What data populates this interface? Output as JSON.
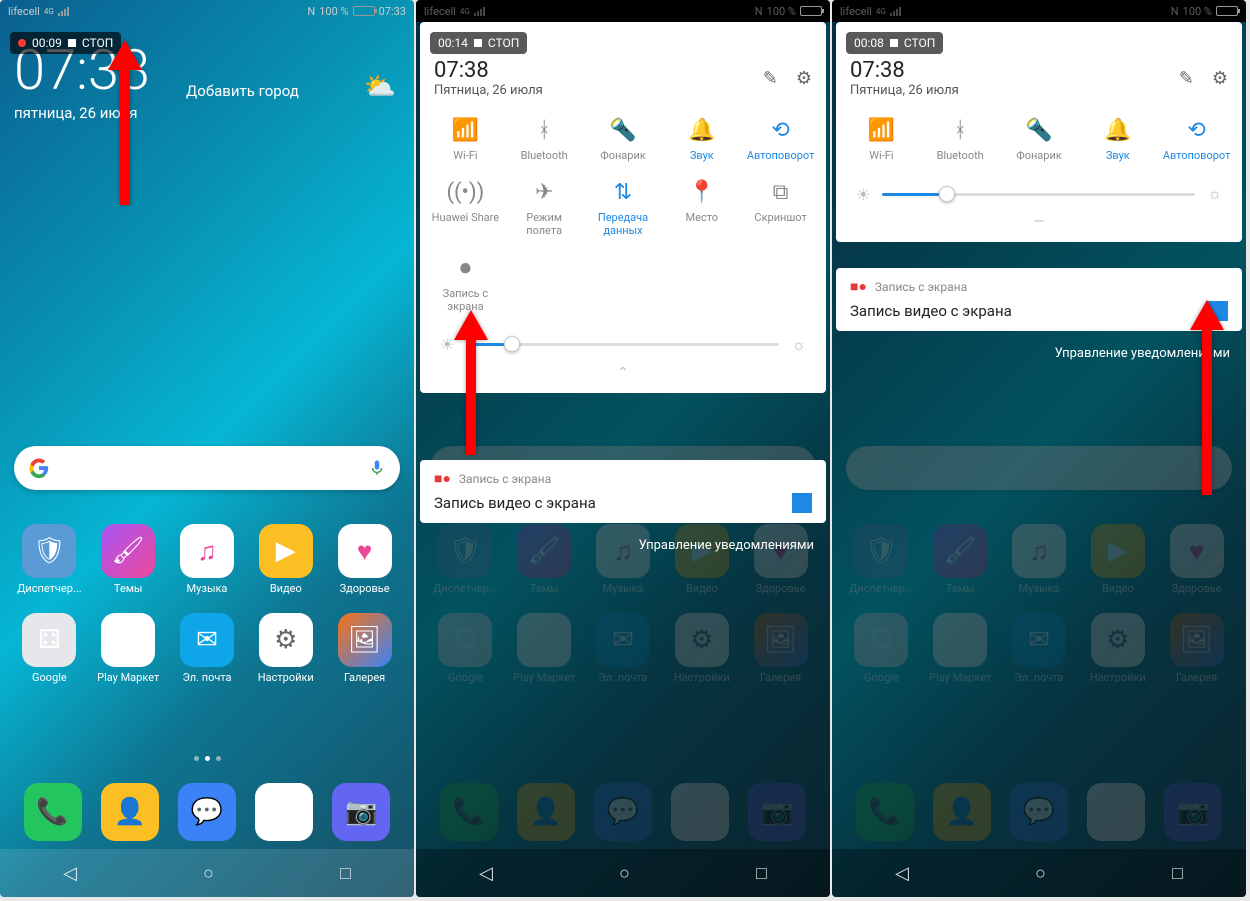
{
  "status": {
    "carrier": "lifecell",
    "net": "4G",
    "nfc": "N",
    "battery": "100 %",
    "time": "07:33"
  },
  "screen1": {
    "rec_time": "00:09",
    "rec_stop": "СТОП",
    "clock": "07:33",
    "add_city": "Добавить город",
    "date": "пятница, 26 июля"
  },
  "screen2": {
    "rec_time": "00:14",
    "rec_stop": "СТОП",
    "qs_time": "07:38",
    "qs_date": "Пятница, 26 июля",
    "brightness_pct": 12
  },
  "screen3": {
    "rec_time": "00:08",
    "rec_stop": "СТОП",
    "qs_time": "07:38",
    "qs_date": "Пятница, 26 июля",
    "brightness_pct": 18
  },
  "qs_toggles_row1": [
    {
      "label": "Wi-Fi",
      "icon": "wifi",
      "active": false
    },
    {
      "label": "Bluetooth",
      "icon": "bt",
      "active": false
    },
    {
      "label": "Фонарик",
      "icon": "torch",
      "active": false
    },
    {
      "label": "Звук",
      "icon": "bell",
      "active": true
    },
    {
      "label": "Автоповорот",
      "icon": "rotate",
      "active": true
    }
  ],
  "qs_toggles_row2": [
    {
      "label": "Huawei Share",
      "icon": "share",
      "active": false
    },
    {
      "label": "Режим полета",
      "icon": "plane",
      "active": false
    },
    {
      "label": "Передача данных",
      "icon": "data",
      "active": true
    },
    {
      "label": "Место",
      "icon": "loc",
      "active": false
    },
    {
      "label": "Скриншот",
      "icon": "scr",
      "active": false
    }
  ],
  "qs_toggles_row3": [
    {
      "label": "Запись с экрана",
      "icon": "rec",
      "active": false
    }
  ],
  "notif": {
    "app": "Запись с экрана",
    "title": "Запись видео с экрана",
    "manage": "Управление уведомлениями"
  },
  "apps_row1": [
    {
      "label": "Диспетчер...",
      "cls": "ic-shield",
      "glyph": "🛡"
    },
    {
      "label": "Темы",
      "cls": "ic-themes",
      "glyph": "🖌"
    },
    {
      "label": "Музыка",
      "cls": "ic-music",
      "glyph": "♫"
    },
    {
      "label": "Видео",
      "cls": "ic-video",
      "glyph": "▶"
    },
    {
      "label": "Здоровье",
      "cls": "ic-health",
      "glyph": "♥"
    }
  ],
  "apps_row2": [
    {
      "label": "Google",
      "cls": "ic-folder",
      "glyph": "⚃"
    },
    {
      "label": "Play Маркет",
      "cls": "ic-play",
      "glyph": "▶"
    },
    {
      "label": "Эл. почта",
      "cls": "ic-mail",
      "glyph": "✉"
    },
    {
      "label": "Настройки",
      "cls": "ic-settings",
      "glyph": "⚙"
    },
    {
      "label": "Галерея",
      "cls": "ic-gallery",
      "glyph": "🖼"
    }
  ],
  "dock": [
    {
      "label": "",
      "cls": "ic-phone",
      "glyph": "📞"
    },
    {
      "label": "",
      "cls": "ic-contacts",
      "glyph": "👤"
    },
    {
      "label": "",
      "cls": "ic-msg",
      "glyph": "💬"
    },
    {
      "label": "",
      "cls": "ic-chrome",
      "glyph": "◉"
    },
    {
      "label": "",
      "cls": "ic-camera",
      "glyph": "📷"
    }
  ]
}
